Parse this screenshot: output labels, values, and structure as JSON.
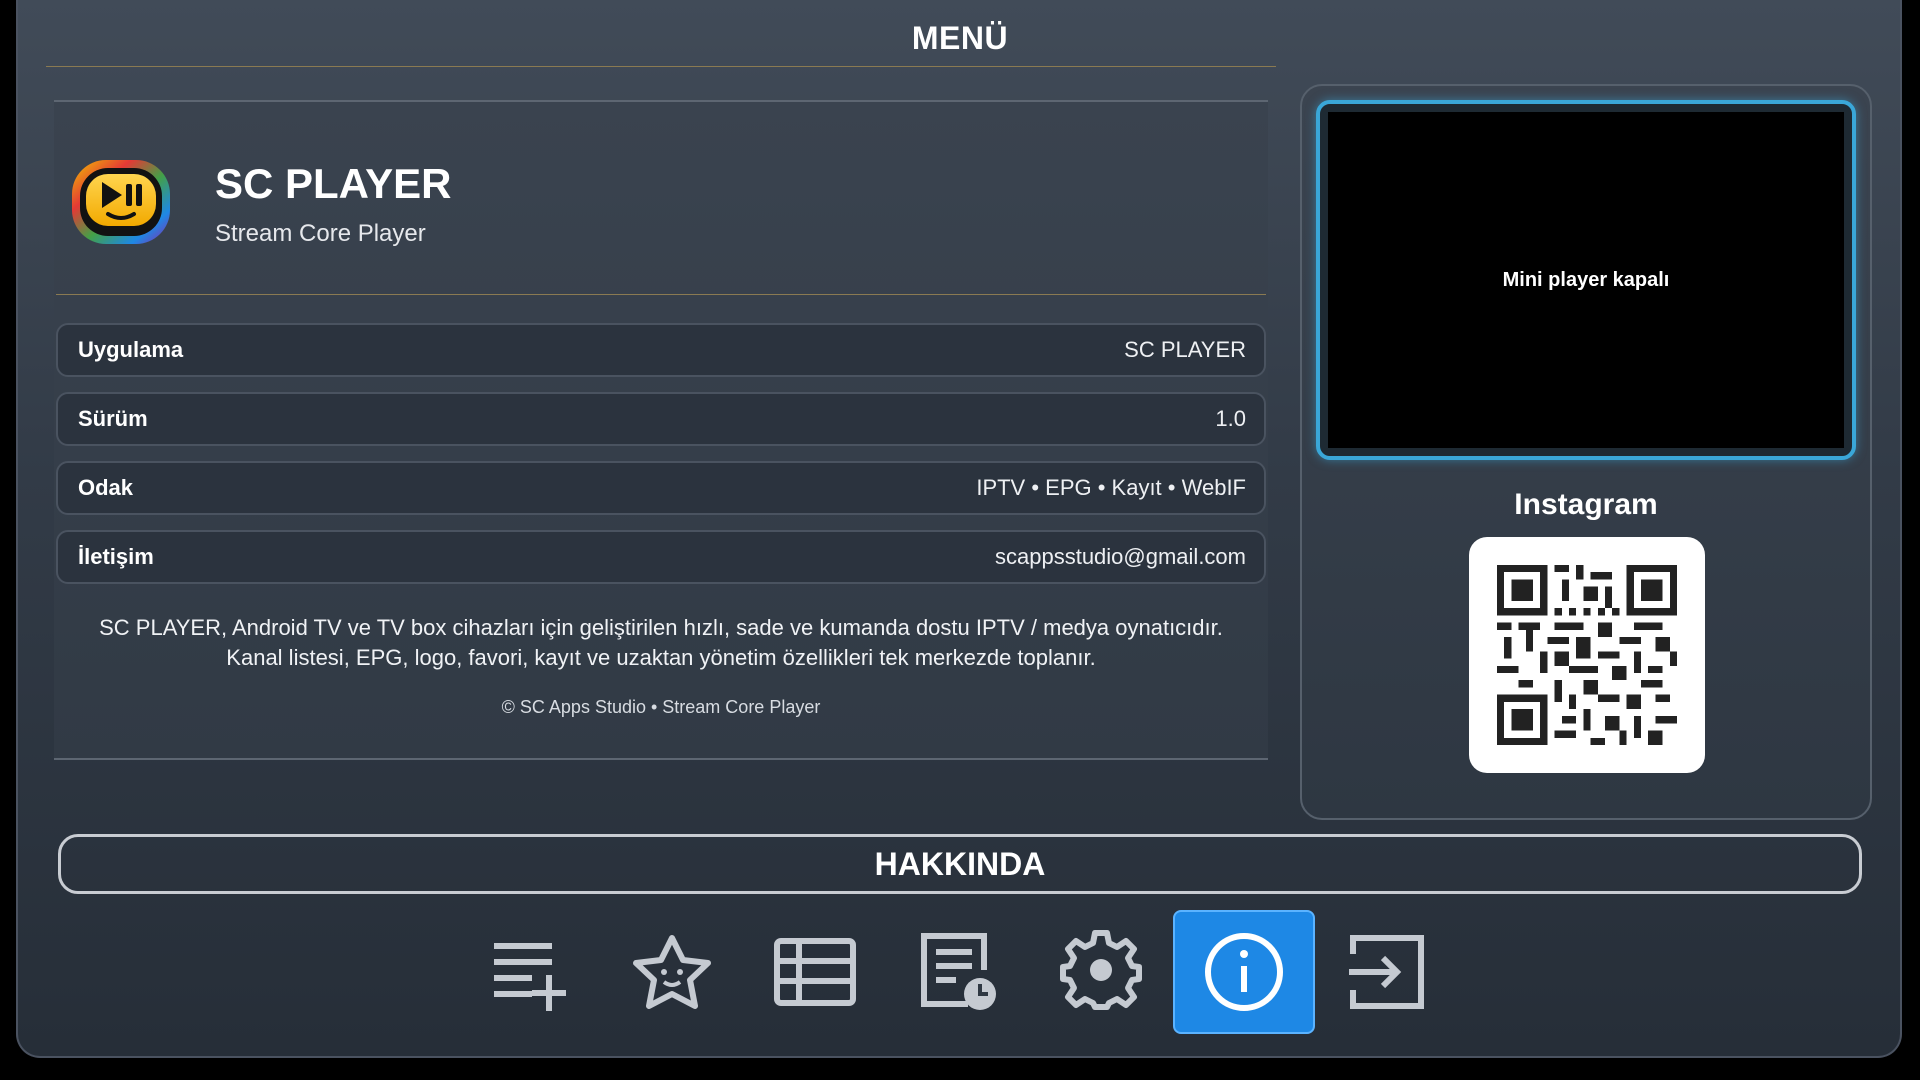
{
  "header": {
    "title": "MENÜ"
  },
  "app": {
    "name": "SC PLAYER",
    "subtitle": "Stream Core Player"
  },
  "info_rows": [
    {
      "key": "Uygulama",
      "value": "SC PLAYER"
    },
    {
      "key": "Sürüm",
      "value": "1.0"
    },
    {
      "key": "Odak",
      "value": "IPTV • EPG • Kayıt • WebIF"
    },
    {
      "key": "İletişim",
      "value": "scappsstudio@gmail.com"
    }
  ],
  "description": {
    "line1": "SC PLAYER, Android TV ve TV box cihazları için geliştirilen hızlı, sade ve kumanda dostu IPTV / medya oynatıcıdır.",
    "line2": "Kanal listesi, EPG, logo, favori, kayıt ve uzaktan yönetim özellikleri tek merkezde toplanır."
  },
  "copyright": "© SC Apps Studio • Stream Core Player",
  "mini_player": {
    "status": "Mini player kapalı"
  },
  "social": {
    "label": "Instagram",
    "qr_icon": "qr-code-icon"
  },
  "section": {
    "title": "HAKKINDA"
  },
  "nav": {
    "items": [
      {
        "icon": "playlist-add-icon",
        "active": false
      },
      {
        "icon": "favorite-star-icon",
        "active": false
      },
      {
        "icon": "channel-list-icon",
        "active": false
      },
      {
        "icon": "epg-schedule-icon",
        "active": false
      },
      {
        "icon": "settings-gear-icon",
        "active": false
      },
      {
        "icon": "info-icon",
        "active": true
      },
      {
        "icon": "exit-icon",
        "active": false
      }
    ]
  },
  "colors": {
    "accent": "#1e88e5",
    "mini_player_border": "#3aa7d8",
    "divider_gold": "#8a7a52"
  }
}
